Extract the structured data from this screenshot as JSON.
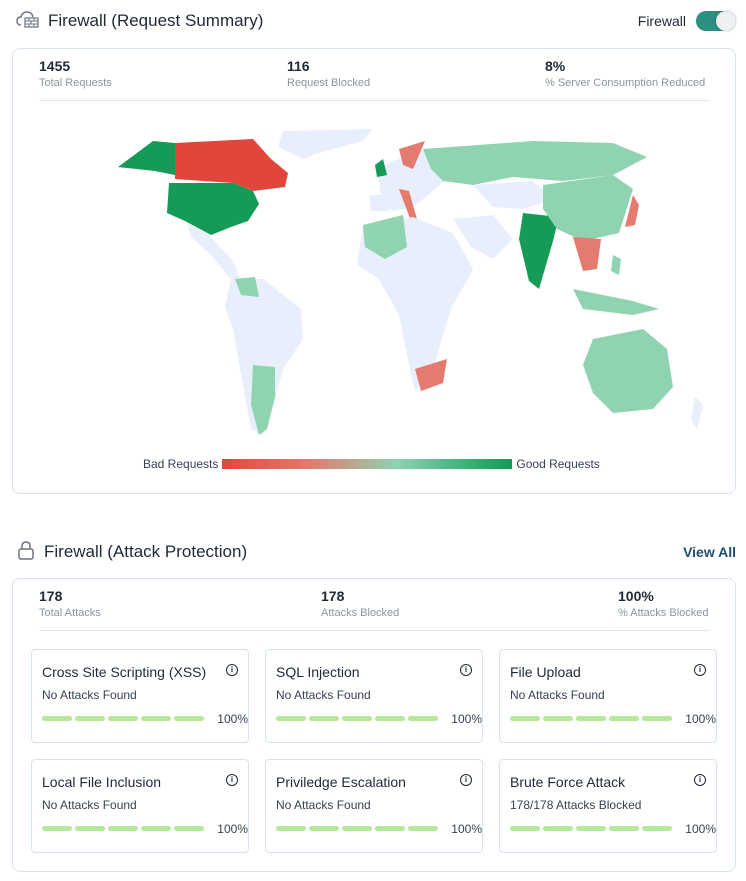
{
  "request_summary": {
    "title": "Firewall (Request Summary)",
    "toggle_label": "Firewall",
    "toggle_on": true,
    "stats": [
      {
        "value": "1455",
        "label": "Total Requests"
      },
      {
        "value": "116",
        "label": "Request Blocked"
      },
      {
        "value": "8%",
        "label": "% Server Consumption Reduced"
      }
    ],
    "legend": {
      "bad": "Bad Requests",
      "good": "Good Requests"
    },
    "colors": {
      "bad": "#e0463b",
      "bad_light": "#e57a6e",
      "good_light": "#8fd3b0",
      "good": "#159a58",
      "none": "#e8eefb"
    }
  },
  "attack_protection": {
    "title": "Firewall (Attack Protection)",
    "view_all": "View All",
    "stats": [
      {
        "value": "178",
        "label": "Total Attacks"
      },
      {
        "value": "178",
        "label": "Attacks Blocked"
      },
      {
        "value": "100%",
        "label": "% Attacks Blocked"
      }
    ],
    "attacks": [
      {
        "title": "Cross Site Scripting (XSS)",
        "status": "No Attacks Found",
        "percent": "100%"
      },
      {
        "title": "SQL Injection",
        "status": "No Attacks Found",
        "percent": "100%"
      },
      {
        "title": "File Upload",
        "status": "No Attacks Found",
        "percent": "100%"
      },
      {
        "title": "Local File Inclusion",
        "status": "No Attacks Found",
        "percent": "100%"
      },
      {
        "title": "Priviledge Escalation",
        "status": "No Attacks Found",
        "percent": "100%"
      },
      {
        "title": "Brute Force Attack",
        "status": "178/178 Attacks Blocked",
        "percent": "100%"
      }
    ]
  }
}
